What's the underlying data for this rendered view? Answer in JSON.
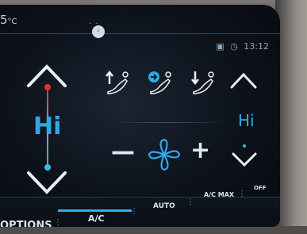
{
  "status": {
    "outside_temp_value": "5",
    "outside_temp_unit": "°C",
    "clock": "13:12"
  },
  "left_zone": {
    "temp_label": "Hi"
  },
  "right_zone": {
    "temp_label": "Hi"
  },
  "airflow": {
    "modes": [
      "face",
      "face-and-feet",
      "feet"
    ],
    "selected": "face-and-feet"
  },
  "fan": {
    "minus": "—",
    "plus": "+"
  },
  "bottom_menu": {
    "options": "OPTIONS",
    "ac": "A/C",
    "auto": "AUTO",
    "ac_max": "A/C MAX",
    "off": "OFF"
  },
  "colors": {
    "accent": "#2ea9e6",
    "indicator_hot": "#e03030",
    "indicator_cold": "#35c0d8"
  }
}
